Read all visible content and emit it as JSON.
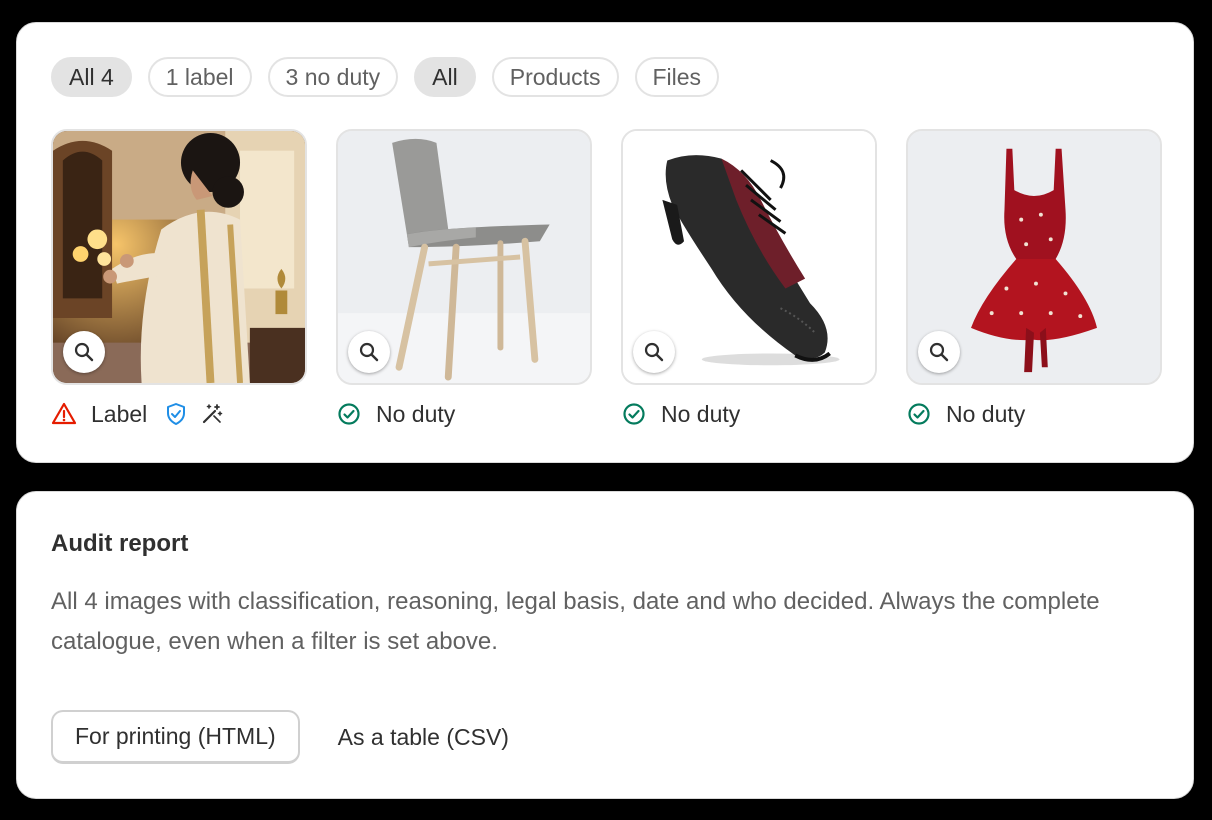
{
  "filters": {
    "status_chips": [
      {
        "label": "All 4",
        "active": true
      },
      {
        "label": "1 label",
        "active": false
      },
      {
        "label": "3 no duty",
        "active": false
      }
    ],
    "type_chips": [
      {
        "label": "All",
        "active": true
      },
      {
        "label": "Products",
        "active": false
      },
      {
        "label": "Files",
        "active": false
      }
    ]
  },
  "tiles": [
    {
      "subject": "woman in embroidered kaftan lighting lanterns",
      "status": "Label",
      "status_icon": "warning-triangle-icon",
      "status_color": "#e51c00",
      "extra_icons": [
        "shield-check-icon",
        "magic-wand-icon"
      ]
    },
    {
      "subject": "grey upholstered chair with wooden legs",
      "status": "No duty",
      "status_icon": "check-circle-icon",
      "status_color": "#047b5d"
    },
    {
      "subject": "black and burgundy brogue shoe",
      "status": "No duty",
      "status_icon": "check-circle-icon",
      "status_color": "#047b5d"
    },
    {
      "subject": "red dress",
      "status": "No duty",
      "status_icon": "check-circle-icon",
      "status_color": "#047b5d"
    }
  ],
  "audit": {
    "title": "Audit report",
    "description": "All 4 images with classification, reasoning, legal basis, date and who decided. Always the complete catalogue, even when a filter is set above.",
    "print_button": "For printing (HTML)",
    "csv_button": "As a table (CSV)"
  },
  "colors": {
    "warning": "#e51c00",
    "success": "#047b5d",
    "shield": "#1f8ee6",
    "chip_active_bg": "#e3e3e3"
  }
}
